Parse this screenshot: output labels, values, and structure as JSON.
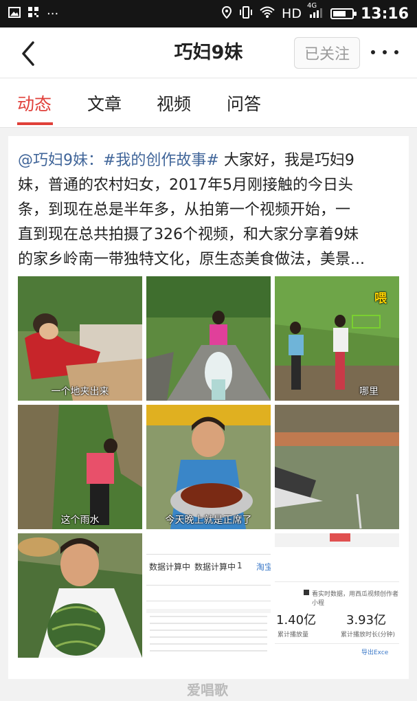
{
  "status_bar": {
    "hd_label": "HD",
    "network": "4G",
    "time": "13:16",
    "battery_level": 0.7,
    "icons": [
      "image-icon",
      "grid-icon",
      "more-dots-icon",
      "location-icon",
      "vibrate-icon",
      "wifi-icon",
      "signal-icon",
      "battery-icon"
    ]
  },
  "header": {
    "title": "巧妇9妹",
    "follow_label": "已关注",
    "back_icon": "chevron-left-icon",
    "more_icon": "more-dots-icon"
  },
  "tabs": [
    {
      "label": "动态",
      "active": true
    },
    {
      "label": "文章",
      "active": false
    },
    {
      "label": "视频",
      "active": false
    },
    {
      "label": "问答",
      "active": false
    }
  ],
  "post": {
    "mention": "@巧妇9妹：",
    "hashtag": "#我的创作故事#",
    "lines": [
      " 大家好，我是巧妇9",
      "妹，普通的农村妇女，2017年5月刚接触的今日头",
      "条，到现在总是半年多，从拍第一个视频开始，一",
      "直到现在总共拍摄了326个视频，和大家分享着9妹",
      "的家乡岭南一带独特文化，原生态美食做法，美景..."
    ],
    "images": [
      {
        "caption": "一个地夹出来"
      },
      {
        "caption": ""
      },
      {
        "caption": "哪里",
        "sticker": "喂"
      },
      {
        "caption": "这个雨水"
      },
      {
        "caption": "今天晚上就是正席了"
      },
      {
        "caption": ""
      },
      {
        "caption": ""
      },
      {
        "caption": "",
        "label_a": "数据计算中",
        "label_b": "数据计算中",
        "label_c": "1",
        "label_d": "淘宝"
      },
      {
        "caption": "",
        "note": "看实时数据，用西瓜视频创作者小程",
        "stat1_value": "1.40亿",
        "stat1_label": "累计播放量",
        "stat2_value": "3.93亿",
        "stat2_label": "累计播放时长(分钟)",
        "export_label": "导出Exce"
      }
    ]
  },
  "watermark": "爱唱歌"
}
